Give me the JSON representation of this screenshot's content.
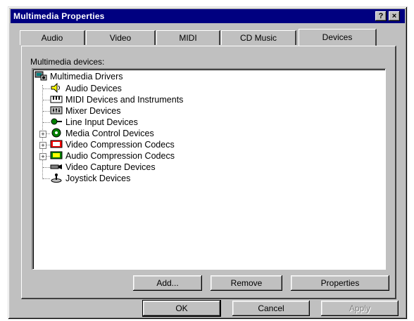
{
  "window": {
    "title": "Multimedia Properties",
    "help_label": "?",
    "close_label": "×"
  },
  "tabs": [
    {
      "label": "Audio"
    },
    {
      "label": "Video"
    },
    {
      "label": "MIDI"
    },
    {
      "label": "CD Music"
    },
    {
      "label": "Devices",
      "active": true
    }
  ],
  "devices": {
    "group_label": "Multimedia devices:",
    "root": "Multimedia Drivers",
    "items": [
      {
        "label": "Audio Devices",
        "icon": "speaker-icon",
        "expandable": false
      },
      {
        "label": "MIDI Devices and Instruments",
        "icon": "midi-keyboard-icon",
        "expandable": false
      },
      {
        "label": "Mixer Devices",
        "icon": "mixer-icon",
        "expandable": false
      },
      {
        "label": "Line Input Devices",
        "icon": "line-input-icon",
        "expandable": false
      },
      {
        "label": "Media Control Devices",
        "icon": "media-control-icon",
        "expandable": true
      },
      {
        "label": "Video Compression Codecs",
        "icon": "video-codec-icon",
        "expandable": true
      },
      {
        "label": "Audio Compression Codecs",
        "icon": "audio-codec-icon",
        "expandable": true
      },
      {
        "label": "Video Capture Devices",
        "icon": "video-capture-icon",
        "expandable": false
      },
      {
        "label": "Joystick Devices",
        "icon": "joystick-icon",
        "expandable": false
      }
    ]
  },
  "panel_buttons": {
    "add": "Add...",
    "remove": "Remove",
    "properties": "Properties"
  },
  "dialog_buttons": {
    "ok": "OK",
    "cancel": "Cancel",
    "apply": "Apply"
  },
  "colors": {
    "title_bar": "#000080",
    "face": "#c0c0c0"
  }
}
